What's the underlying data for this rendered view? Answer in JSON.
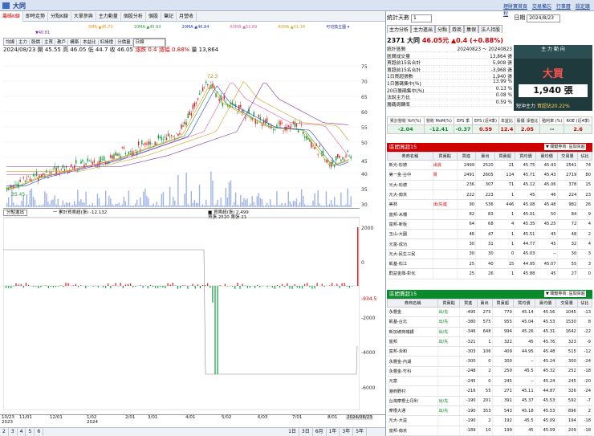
{
  "window": {
    "title": "大同",
    "top_links": [
      "理財寶首頁",
      "交易備忘",
      "行事曆",
      "設定議程"
    ]
  },
  "tabs": [
    "籌碼K線",
    "即時走勢",
    "分點K線",
    "大單參與",
    "主力動量",
    "個股分析",
    "個股",
    "筆記",
    "月營收"
  ],
  "ma_legend": [
    "5MA ▲45.70",
    "10MA ▲45.93",
    "20MA ▲46.84",
    "60MA ▲52.89",
    "80MA ▲51.34",
    "▼40.81",
    "可切換主圖 ▾"
  ],
  "sub_tabs": [
    "均線",
    "主力",
    "股價",
    "主買",
    "散戶",
    "構築",
    "本益比",
    "紅綠燈",
    "分價量",
    "日線"
  ],
  "quote": {
    "date": "2024/08/23",
    "open": "開 45.55",
    "high": "高 46.05",
    "low": "低 44.7",
    "close": "收 46.05",
    "change": "漲跌 0.4",
    "pct": "漲幅 0.88%",
    "vol": "量 13,864"
  },
  "price_ticks": [
    "75",
    "70",
    "65",
    "60",
    "55",
    "50",
    "45",
    "40",
    "35",
    "30"
  ],
  "labels": {
    "high": "72.3",
    "low": "35.45"
  },
  "sub_header": {
    "select": "分點進出",
    "legend": "一 累計買賣超(張) -12,132",
    "legend2": "■ 買賣超(張) 2,499",
    "detail": "買張 2520 賣張 21"
  },
  "sub_ticks": [
    "2000",
    "0",
    "-934.5",
    "-2000",
    "-4000",
    "-6000"
  ],
  "x_ticks": [
    "10/23",
    "11/01",
    "12/01",
    "1/02",
    "2/01",
    "3/01",
    "4/01",
    "5/02",
    "6/03",
    "7/01",
    "8/01",
    "2024/08/23"
  ],
  "x_years": [
    "2023",
    "2024"
  ],
  "bottom_bar": [
    "2",
    "3",
    "4",
    "5",
    "6",
    "1日",
    "3日",
    "6月",
    "1年",
    "3年",
    "5年"
  ],
  "right": {
    "stats_label": "統計天數",
    "stats_days": "1",
    "date_label": "日期",
    "date": "2024/8/23",
    "mini_tabs": [
      "主力分析",
      "主力進出",
      "分點",
      "券商",
      "集保",
      "法人持股"
    ],
    "stock": {
      "name": "2371 大同",
      "price": "46.05元",
      "change": "▲0.4 (+0.88%)"
    },
    "kv": [
      [
        "統計區間",
        "20240823 ～ 20240823"
      ],
      [
        "區間成交量",
        "13,864 張"
      ],
      [
        "買超前15名合計",
        "5,908 張"
      ],
      [
        "賣超前15名合計",
        "-3,968 張"
      ],
      [
        "1日買超張數",
        "1,940 張"
      ],
      [
        "1日籌碼集中(%)",
        "13.99 %"
      ],
      [
        "20日籌碼集中(%)",
        "0.13 %"
      ],
      [
        "法說主力比",
        "0.08 %"
      ],
      [
        "籌碼周轉率",
        "0.59 %"
      ]
    ],
    "main_force": {
      "header": "主 力 動 向",
      "big": "大買",
      "vol": "1,940 張",
      "short": "短沖主力",
      "short_val": "買超佔20.22%"
    },
    "stats": {
      "heads": [
        "累計營收 YoY(%)",
        "營收 MoM(%)",
        "EPS 季",
        "EPS (近4季)",
        "本益比",
        "股價 淨值比",
        "殖利率 (%)",
        "ROE (近4季)"
      ],
      "vals": [
        "-2.04",
        "-12.41",
        "-0.37",
        "0.59",
        "12.4",
        "2.05",
        "--",
        "2.6"
      ]
    },
    "buy_title": "區間買超15",
    "sell_title": "區間賣超15",
    "dropdown": "▼ 關鍵券商: 區間買超15",
    "cols": [
      "券商名稱",
      "買賣點",
      "買進",
      "賣出",
      "買賣超",
      "買均價",
      "賣均價",
      "交易量",
      "佔比"
    ],
    "buy_rows": [
      [
        "新光-松德",
        "出資",
        "2499",
        "2520",
        "21",
        "45.75",
        "45.43",
        "2541",
        "74"
      ],
      [
        "第一金-台中",
        "買",
        "2491",
        "2605",
        "114",
        "45.71",
        "45.43",
        "2719",
        "80"
      ],
      [
        "元大-松德",
        "",
        "236",
        "307",
        "71",
        "45.12",
        "45.06",
        "378",
        "15"
      ],
      [
        "元大-南京",
        "",
        "222",
        "223",
        "1",
        "45",
        "46",
        "224",
        "23"
      ],
      [
        "美林",
        "出/先進",
        "90",
        "536",
        "446",
        "45.08",
        "45.48",
        "982",
        "26"
      ],
      [
        "富邦-木柵",
        "",
        "82",
        "83",
        "1",
        "45.01",
        "50",
        "84",
        "9"
      ],
      [
        "富邦-新板",
        "",
        "64",
        "68",
        "4",
        "45.35",
        "45.25",
        "72",
        "4"
      ],
      [
        "玉山-大園",
        "",
        "46",
        "47",
        "1",
        "45.51",
        "45",
        "48",
        "2"
      ],
      [
        "元富-成功",
        "",
        "30",
        "31",
        "1",
        "44.77",
        "45",
        "32",
        "4"
      ],
      [
        "元大-民生三民",
        "",
        "30",
        "30",
        "0",
        "45.03",
        "--",
        "30",
        "3"
      ],
      [
        "凱基-松江",
        "",
        "25",
        "40",
        "15",
        "44.95",
        "45.07",
        "55",
        "3"
      ],
      [
        "群益金鼎-彰化",
        "",
        "25",
        "26",
        "1",
        "45.88",
        "45",
        "27",
        "0"
      ]
    ],
    "sell_rows": [
      [
        "永豐金",
        "出/先",
        "-495",
        "275",
        "770",
        "45.14",
        "45.56",
        "1045",
        "-13"
      ],
      [
        "凱基-台北",
        "出/先",
        "-380",
        "575",
        "955",
        "45.04",
        "45.53",
        "1530",
        "8"
      ],
      [
        "新加坡商瑞銀",
        "出/先",
        "-346",
        "648",
        "994",
        "45.26",
        "45.31",
        "1642",
        "-22"
      ],
      [
        "富邦",
        "出/先",
        "-321",
        "1",
        "322",
        "45",
        "45.76",
        "323",
        "-9"
      ],
      [
        "富邦-永和",
        "",
        "-303",
        "106",
        "409",
        "44.95",
        "45.48",
        "515",
        "-12"
      ],
      [
        "永豐金-內湖",
        "",
        "-300",
        "0",
        "300",
        "--",
        "45.24",
        "300",
        "-24"
      ],
      [
        "永豐金-竹科",
        "",
        "-248",
        "2",
        "250",
        "45.5",
        "45.32",
        "252",
        "-18"
      ],
      [
        "元富",
        "",
        "-245",
        "0",
        "245",
        "--",
        "45.24",
        "245",
        "-20"
      ],
      [
        "港商野村",
        "",
        "-216",
        "55",
        "271",
        "45.11",
        "44.87",
        "326",
        "-24"
      ],
      [
        "台灣摩根士丹利",
        "出/先",
        "-190",
        "201",
        "391",
        "45.37",
        "45.53",
        "592",
        "-7"
      ],
      [
        "摩根大通",
        "出/先",
        "-190",
        "353",
        "543",
        "45.18",
        "45.53",
        "896",
        "2"
      ],
      [
        "元大-大益",
        "",
        "-190",
        "2",
        "192",
        "45.5",
        "45.09",
        "194",
        "-18"
      ],
      [
        "富邦-南京",
        "",
        "-189",
        "10",
        "199",
        "45",
        "45.09",
        "209",
        "-18"
      ]
    ]
  }
}
